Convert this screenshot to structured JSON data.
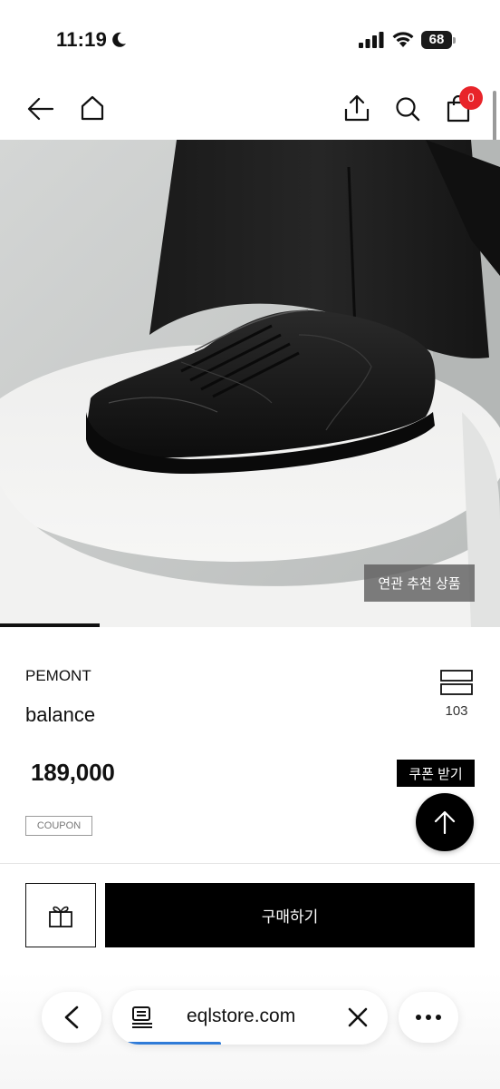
{
  "status_bar": {
    "time": "11:19",
    "battery": "68"
  },
  "nav": {
    "cart_count": "0"
  },
  "hero": {
    "related_label": "연관 추천 상품",
    "progress": 0.2
  },
  "product": {
    "brand": "PEMONT",
    "name": "balance",
    "like_count": "103",
    "price": "189,000",
    "coupon_button": "쿠폰 받기",
    "coupon_tag": "COUPON"
  },
  "actions": {
    "buy_label": "구매하기"
  },
  "browser": {
    "url": "eqlstore.com"
  },
  "icons": {
    "back": "arrow-left-icon",
    "home": "home-icon",
    "share": "share-icon",
    "search": "search-icon",
    "cart": "shopping-bag-icon",
    "like": "bookmark-icon",
    "gift": "gift-icon",
    "scroll_top": "arrow-up-icon",
    "browser_back": "chevron-left-icon",
    "reader": "reader-icon",
    "close": "close-icon",
    "more": "more-icon"
  },
  "colors": {
    "badge": "#e8242a",
    "primary": "#000000",
    "load_bar": "#2f7bd8"
  }
}
